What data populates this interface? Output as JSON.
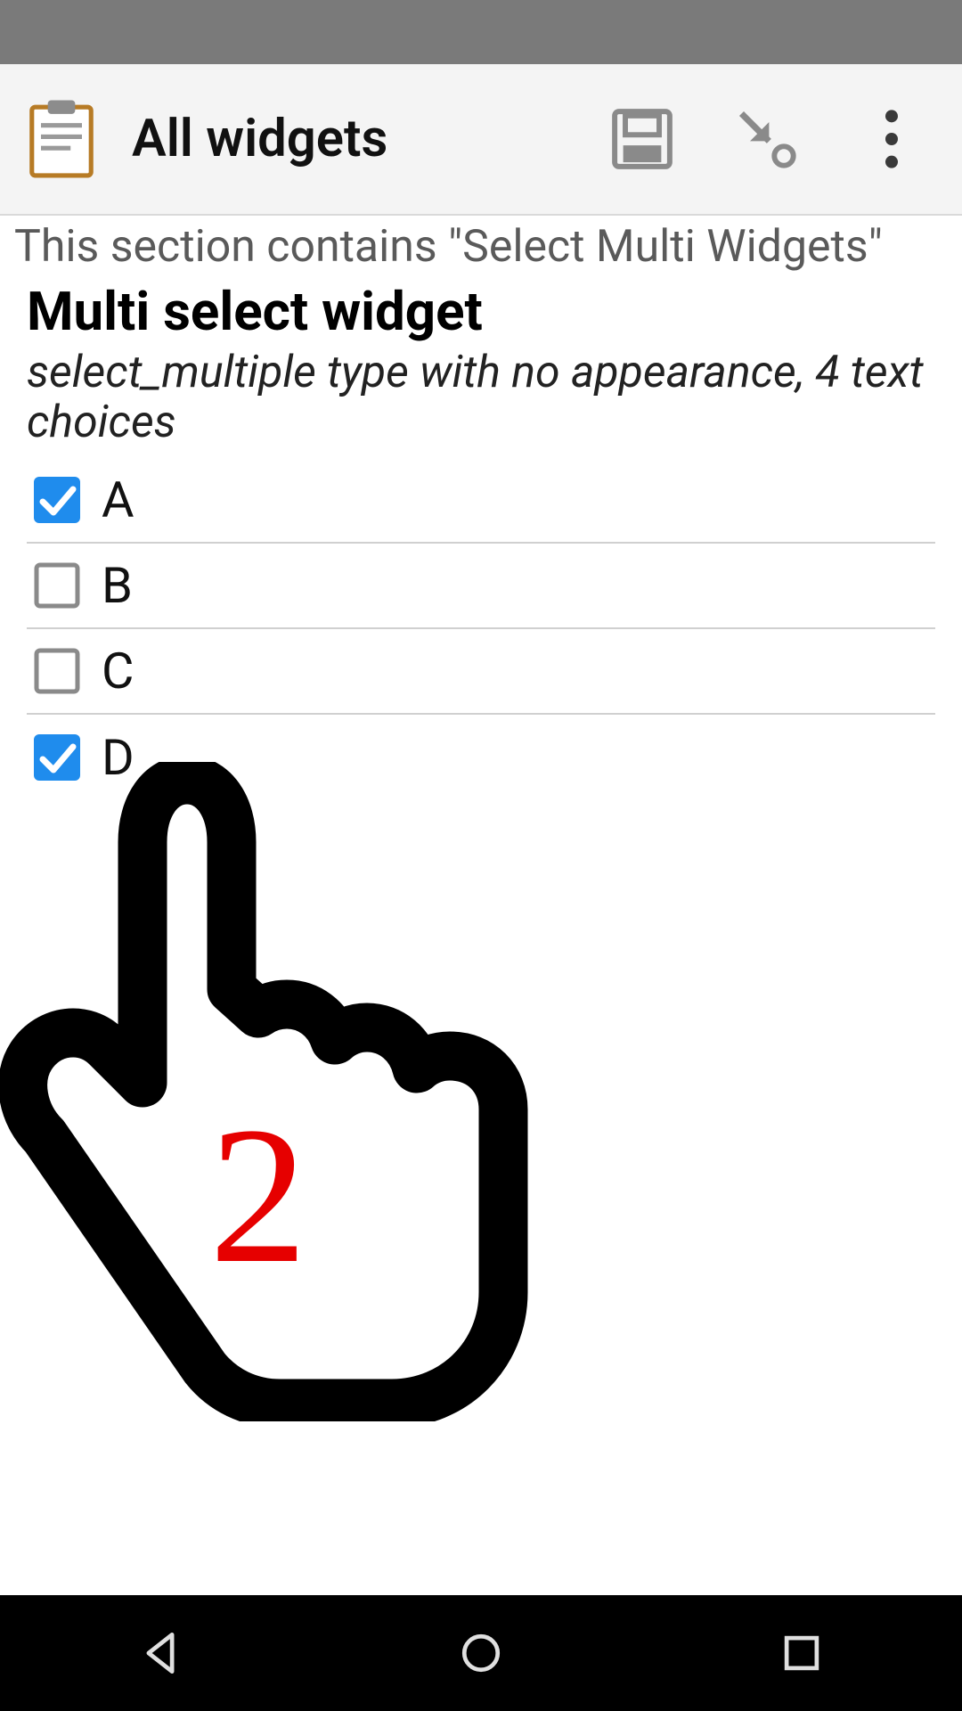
{
  "header": {
    "title": "All widgets",
    "icons": {
      "app": "clipboard-icon",
      "save": "save-icon",
      "jump": "arrow-down-right-icon",
      "overflow": "more-vert-icon"
    }
  },
  "section": {
    "caption": "This section contains \"Select Multi Widgets\"",
    "question_title": "Multi select widget",
    "question_hint": "select_multiple type with no appearance, 4 text choices"
  },
  "choices": [
    {
      "label": "A",
      "checked": true
    },
    {
      "label": "B",
      "checked": false
    },
    {
      "label": "C",
      "checked": false
    },
    {
      "label": "D",
      "checked": true
    }
  ],
  "overlay": {
    "pointer_number": "2"
  },
  "colors": {
    "checkbox_checked": "#1f8ced",
    "checkbox_unchecked": "#8a8a8a",
    "overlay_number": "#e60000"
  }
}
